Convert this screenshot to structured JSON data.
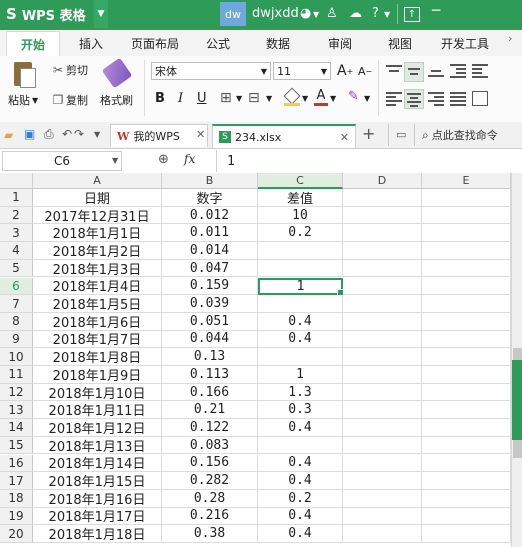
{
  "titlebar": {
    "app_logo": "S",
    "app_name": "WPS 表格",
    "dropdown_glyph": "▼",
    "avatar_text": "dw",
    "username": "dwjxdd",
    "icons": [
      "skin-icon",
      "dropdown-icon",
      "shirt-icon",
      "cloud-icon",
      "help-icon",
      "menu-icon",
      "restore-icon",
      "minimize-icon"
    ]
  },
  "menu": {
    "tabs": [
      "开始",
      "插入",
      "页面布局",
      "公式",
      "数据",
      "审阅",
      "视图",
      "开发工具"
    ],
    "active": "开始"
  },
  "ribbon": {
    "paste": "粘贴",
    "cut": "剪切",
    "copy": "复制",
    "format_painter": "格式刷",
    "font_name": "宋体",
    "font_size": "11",
    "bold": "B",
    "italic": "I",
    "underline": "U",
    "grow_font": "A",
    "shrink_font": "A"
  },
  "doctabs": {
    "tab1": "我的WPS",
    "tab2": "234.xlsx",
    "add": "+",
    "search": "点此查找命令"
  },
  "formula_bar": {
    "name_box": "C6",
    "fx": "fx",
    "value": "1"
  },
  "sheet": {
    "columns": [
      "A",
      "B",
      "C",
      "D",
      "E"
    ],
    "rows": [
      {
        "n": "1",
        "a": "日期",
        "b": "数字",
        "c": "差值"
      },
      {
        "n": "2",
        "a": "2017年12月31日",
        "b": "0.012",
        "c": "10"
      },
      {
        "n": "3",
        "a": "2018年1月1日",
        "b": "0.011",
        "c": "0.2"
      },
      {
        "n": "4",
        "a": "2018年1月2日",
        "b": "0.014",
        "c": ""
      },
      {
        "n": "5",
        "a": "2018年1月3日",
        "b": "0.047",
        "c": ""
      },
      {
        "n": "6",
        "a": "2018年1月4日",
        "b": "0.159",
        "c": "1"
      },
      {
        "n": "7",
        "a": "2018年1月5日",
        "b": "0.039",
        "c": ""
      },
      {
        "n": "8",
        "a": "2018年1月6日",
        "b": "0.051",
        "c": "0.4"
      },
      {
        "n": "9",
        "a": "2018年1月7日",
        "b": "0.044",
        "c": "0.4"
      },
      {
        "n": "10",
        "a": "2018年1月8日",
        "b": "0.13",
        "c": ""
      },
      {
        "n": "11",
        "a": "2018年1月9日",
        "b": "0.113",
        "c": "1"
      },
      {
        "n": "12",
        "a": "2018年1月10日",
        "b": "0.166",
        "c": "1.3"
      },
      {
        "n": "13",
        "a": "2018年1月11日",
        "b": "0.21",
        "c": "0.3"
      },
      {
        "n": "14",
        "a": "2018年1月12日",
        "b": "0.122",
        "c": "0.4"
      },
      {
        "n": "15",
        "a": "2018年1月13日",
        "b": "0.083",
        "c": ""
      },
      {
        "n": "16",
        "a": "2018年1月14日",
        "b": "0.156",
        "c": "0.4"
      },
      {
        "n": "17",
        "a": "2018年1月15日",
        "b": "0.282",
        "c": "0.4"
      },
      {
        "n": "18",
        "a": "2018年1月16日",
        "b": "0.28",
        "c": "0.2"
      },
      {
        "n": "19",
        "a": "2018年1月17日",
        "b": "0.216",
        "c": "0.4"
      },
      {
        "n": "20",
        "a": "2018年1月18日",
        "b": "0.38",
        "c": "0.4"
      }
    ],
    "selected_cell": "C6"
  },
  "colors": {
    "brand": "#2e9b59",
    "selection": "#2e9b59",
    "header_bg": "#f1f1f1"
  }
}
